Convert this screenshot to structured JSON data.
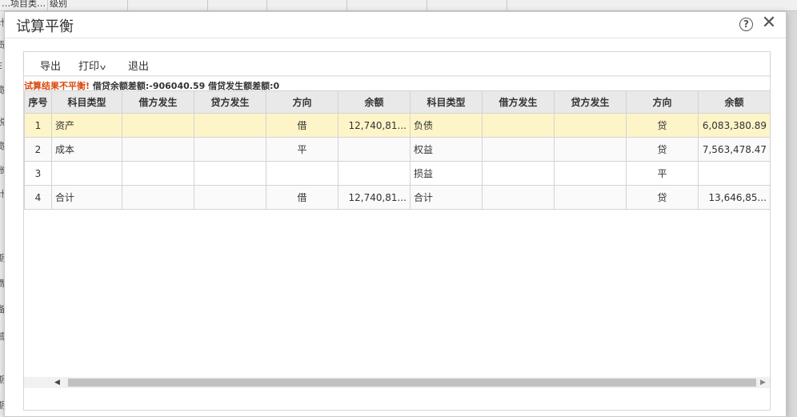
{
  "background": {
    "top_cells": [
      "…项目类…",
      "级别"
    ],
    "left_glyphs": [
      "计",
      "贡",
      "E",
      "宽",
      "税",
      "宽",
      "账",
      "计",
      "期",
      "费",
      "备",
      "营",
      "期",
      "期"
    ]
  },
  "dialog": {
    "title": "试算平衡"
  },
  "toolbar": {
    "export_label": "导出",
    "print_label": "打印",
    "exit_label": "退出"
  },
  "message": {
    "error": "试算结果不平衡!",
    "detail": "借贷余额差额:-906040.59 借贷发生额差额:0"
  },
  "table": {
    "headers": [
      "序号",
      "科目类型",
      "借方发生",
      "贷方发生",
      "方向",
      "余额",
      "科目类型",
      "借方发生",
      "贷方发生",
      "方向",
      "余额"
    ],
    "rows": [
      [
        "1",
        "资产",
        "",
        "",
        "借",
        "12,740,81...",
        "负债",
        "",
        "",
        "贷",
        "6,083,380.89"
      ],
      [
        "2",
        "成本",
        "",
        "",
        "平",
        "",
        "权益",
        "",
        "",
        "贷",
        "7,563,478.47"
      ],
      [
        "3",
        "",
        "",
        "",
        "",
        "",
        "损益",
        "",
        "",
        "平",
        ""
      ],
      [
        "4",
        "合计",
        "",
        "",
        "借",
        "12,740,81...",
        "合计",
        "",
        "",
        "贷",
        "13,646,85..."
      ]
    ]
  },
  "scrollbar": {
    "position": 0
  }
}
